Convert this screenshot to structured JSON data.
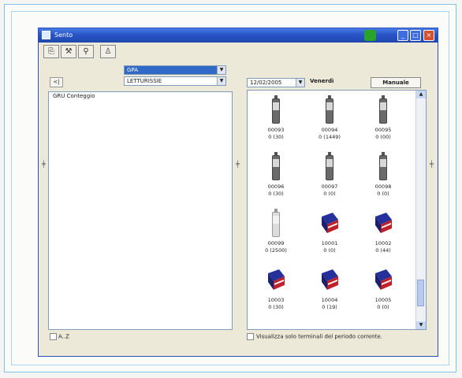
{
  "window": {
    "title": "Sento"
  },
  "toolbar": {
    "icons": [
      "copy-icon",
      "tools-icon",
      "user-icon",
      "person-icon"
    ]
  },
  "filters": {
    "group_value": "GPA",
    "reader_value": "LETTURISSIE"
  },
  "left_panel": {
    "prev_button": "<|",
    "header": "GRU Conteggio",
    "az_label": "A..Z"
  },
  "right_panel": {
    "date": "12/02/2005",
    "day": "Venerdì",
    "manual_button": "Manuale",
    "footer_label": "Visualizza solo terminali del periodo corrente.",
    "tiles": [
      {
        "code": "00093",
        "count": "0 (30)",
        "kind": "phone"
      },
      {
        "code": "00094",
        "count": "0 (1449)",
        "kind": "phone"
      },
      {
        "code": "00095",
        "count": "0 (00)",
        "kind": "phone"
      },
      {
        "code": "00096",
        "count": "0 (30)",
        "kind": "phone"
      },
      {
        "code": "00097",
        "count": "0 (0)",
        "kind": "phone"
      },
      {
        "code": "00098",
        "count": "0 (0)",
        "kind": "phone"
      },
      {
        "code": "00099",
        "count": "0 (2500)",
        "kind": "phone-light"
      },
      {
        "code": "10001",
        "count": "0 (0)",
        "kind": "card"
      },
      {
        "code": "10002",
        "count": "0 (44)",
        "kind": "card"
      },
      {
        "code": "10003",
        "count": "0 (30)",
        "kind": "card"
      },
      {
        "code": "10004",
        "count": "0 (19)",
        "kind": "card"
      },
      {
        "code": "10005",
        "count": "0 (0)",
        "kind": "card"
      }
    ]
  },
  "colors": {
    "titlebar": "#2855c9",
    "window_bg": "#ece9d8",
    "card_blue": "#25309a",
    "card_red": "#c0202a"
  }
}
